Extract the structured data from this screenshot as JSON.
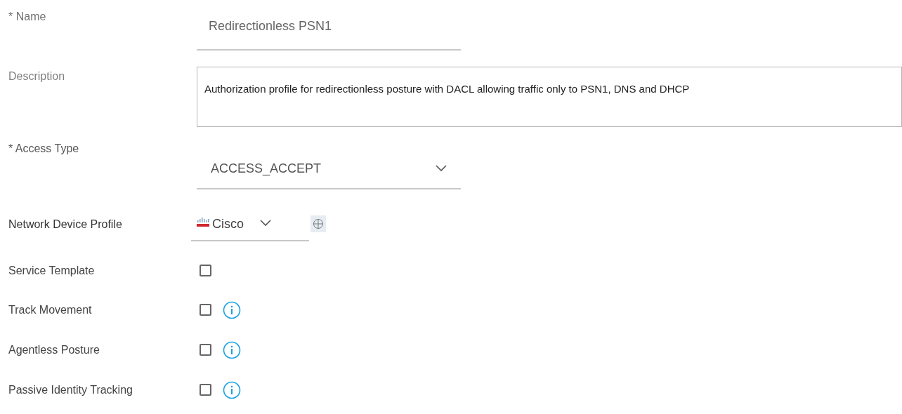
{
  "fields": [
    {
      "kind": "text",
      "label": "* Name",
      "value": "Redirectionless PSN1"
    },
    {
      "kind": "textarea",
      "label": "Description",
      "value": "Authorization profile for redirectionless posture with DACL allowing traffic only to PSN1, DNS and DHCP"
    },
    {
      "kind": "select",
      "label": "* Access Type",
      "value": "ACCESS_ACCEPT"
    },
    {
      "kind": "device",
      "label": "Network Device Profile",
      "value": "Cisco"
    }
  ],
  "options": [
    {
      "label": "Service Template",
      "checked": false,
      "info": false
    },
    {
      "label": "Track Movement",
      "checked": false,
      "info": true
    },
    {
      "label": "Agentless Posture",
      "checked": false,
      "info": true
    },
    {
      "label": "Passive Identity Tracking",
      "checked": false,
      "info": true
    }
  ]
}
